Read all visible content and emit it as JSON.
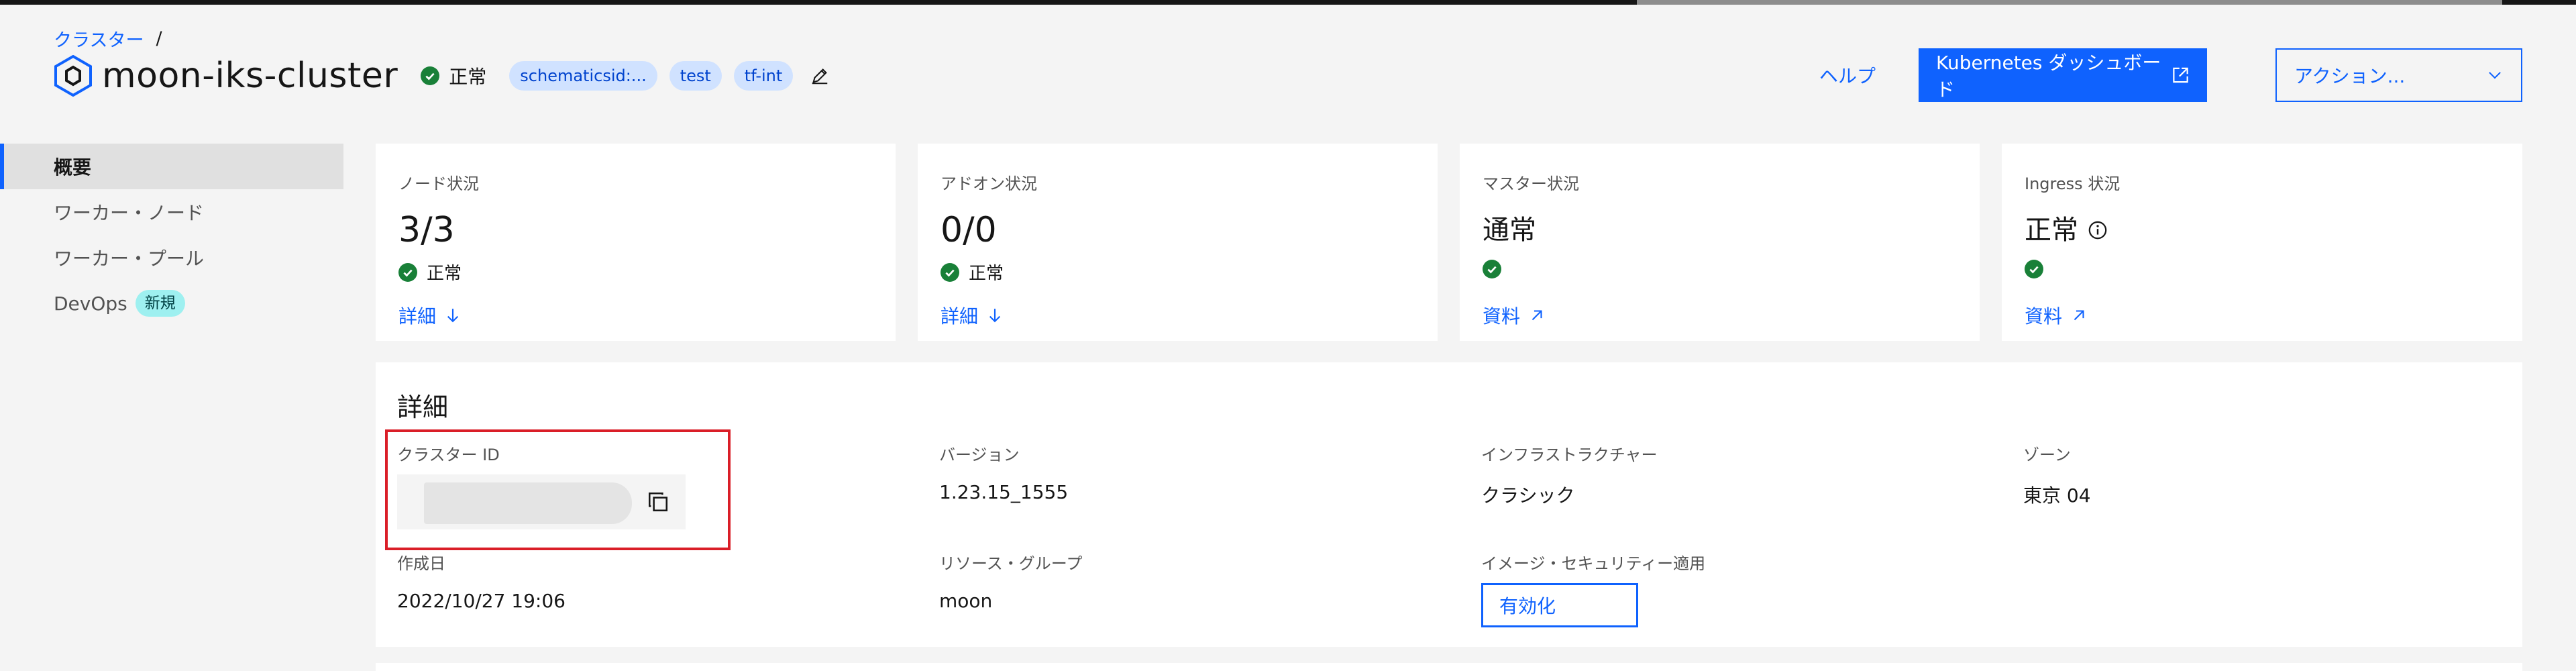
{
  "breadcrumb": {
    "root": "クラスター",
    "separator": "/"
  },
  "cluster": {
    "name": "moon-iks-cluster",
    "status": "正常",
    "tags": [
      "schematicsid:...",
      "test",
      "tf-int"
    ]
  },
  "header": {
    "help": "ヘルプ",
    "k8s_dashboard": "Kubernetes ダッシュボード",
    "actions": "アクション..."
  },
  "sidebar": {
    "items": [
      {
        "label": "概要",
        "active": true
      },
      {
        "label": "ワーカー・ノード"
      },
      {
        "label": "ワーカー・プール"
      },
      {
        "label": "DevOps",
        "badge": "新規"
      }
    ]
  },
  "tiles": [
    {
      "label": "ノード状況",
      "value": "3/3",
      "status": "正常",
      "link": "詳細"
    },
    {
      "label": "アドオン状況",
      "value": "0/0",
      "status": "正常",
      "link": "詳細"
    },
    {
      "label": "マスター状況",
      "value": "通常",
      "status": "",
      "link": "資料"
    },
    {
      "label": "Ingress 状況",
      "value": "正常",
      "status": "",
      "link": "資料"
    }
  ],
  "details": {
    "title": "詳細",
    "cluster_id_label": "クラスター ID",
    "version_label": "バージョン",
    "version_value": "1.23.15_1555",
    "infra_label": "インフラストラクチャー",
    "infra_value": "クラシック",
    "zone_label": "ゾーン",
    "zone_value": "東京 04",
    "created_label": "作成日",
    "created_value": "2022/10/27 19:06",
    "resource_group_label": "リソース・グループ",
    "resource_group_value": "moon",
    "image_security_label": "イメージ・セキュリティー適用",
    "image_security_button": "有効化"
  },
  "colors": {
    "accent": "#0f62fe",
    "success": "#198038",
    "highlight": "#da1e28",
    "tag_bg": "#d0e2ff",
    "new_badge_bg": "#9ef0f0"
  }
}
